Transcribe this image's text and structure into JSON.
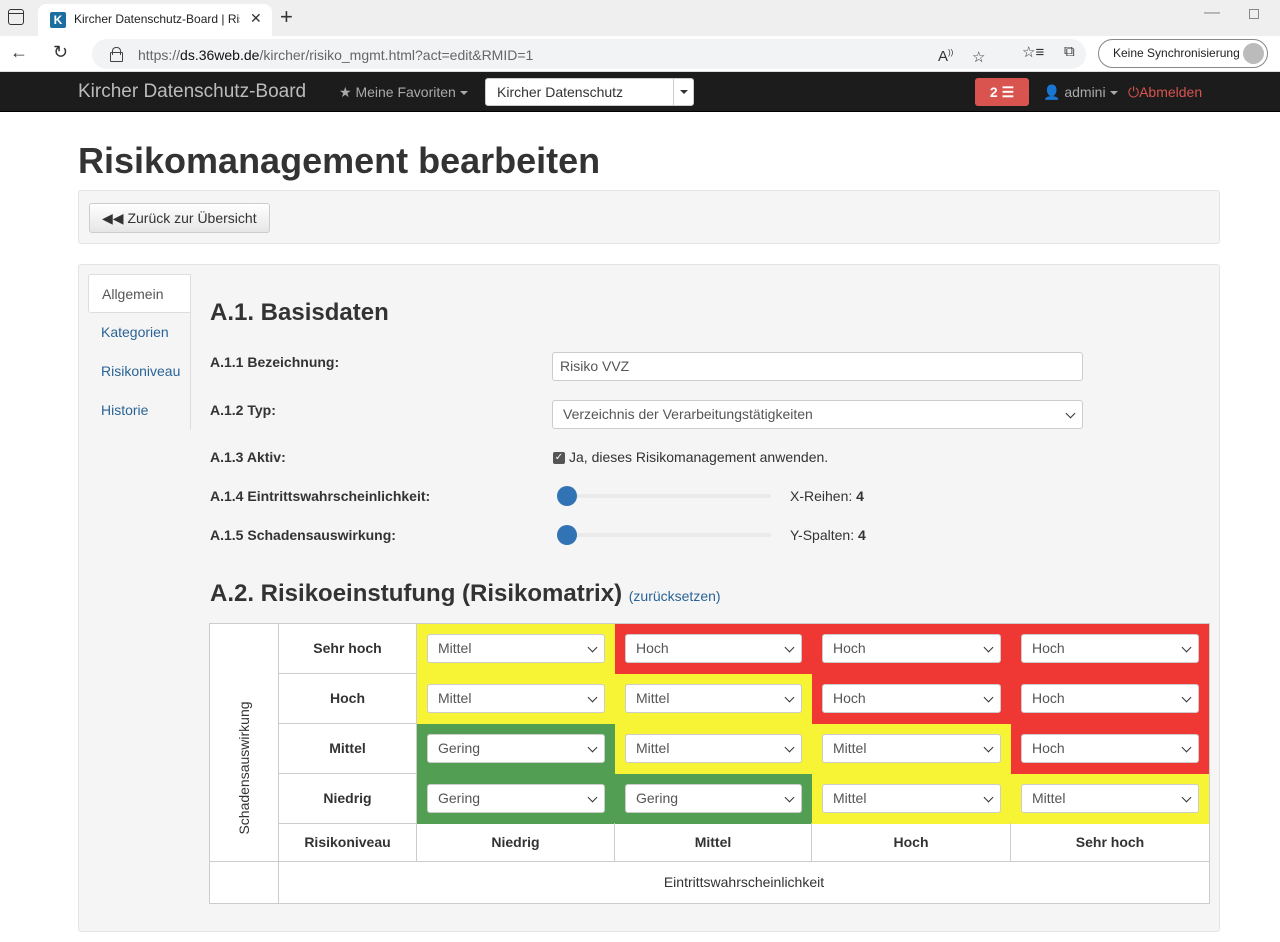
{
  "browser": {
    "tab_title": "Kircher Datenschutz-Board | Risiko",
    "url_prefix": "https://",
    "url_host": "ds.36web.de",
    "url_path": "/kircher/risiko_mgmt.html?act=edit&RMID=1",
    "sync_label": "Keine Synchronisierung",
    "icons": [
      "window-icon",
      "favicon-k",
      "close-icon",
      "plus-icon",
      "back-arrow-icon",
      "reload-icon",
      "lock-icon",
      "read-aloud-icon",
      "favorite-add-icon",
      "favorites-icon",
      "collections-icon",
      "avatar-icon",
      "minimize-icon",
      "maximize-icon"
    ]
  },
  "navbar": {
    "brand": "Kircher Datenschutz-Board",
    "favorites": "Meine Favoriten",
    "selected_company": "Kircher Datenschutz",
    "notification_count": "2",
    "user": "admini",
    "logout": "Abmelden",
    "accent": "#d9534f"
  },
  "page": {
    "title": "Risikomanagement bearbeiten",
    "back_button": "Zurück zur Übersicht"
  },
  "side_nav": {
    "items": [
      "Allgemein",
      "Kategorien",
      "Risikoniveau",
      "Historie"
    ],
    "active": "Allgemein"
  },
  "basisdaten": {
    "heading": "A.1. Basisdaten",
    "bezeichnung_label": "A.1.1 Bezeichnung:",
    "bezeichnung_value": "Risiko VVZ",
    "typ_label": "A.1.2 Typ:",
    "typ_value": "Verzeichnis der Verarbeitungstätigkeiten",
    "aktiv_label": "A.1.3 Aktiv:",
    "aktiv_checked": true,
    "aktiv_text": "Ja, dieses Risikomanagement anwenden.",
    "eintritt_label": "A.1.4 Eintrittswahrscheinlichkeit:",
    "eintritt_prefix": "X-Reihen:",
    "eintritt_value": "4",
    "schaden_label": "A.1.5 Schadensauswirkung:",
    "schaden_prefix": "Y-Spalten:",
    "schaden_value": "4"
  },
  "matrix": {
    "heading": "A.2. Risikoeinstufung (Risikomatrix)",
    "reset_link": "(zurücksetzen)",
    "y_axis_label": "Schadensauswirkung",
    "x_axis_label": "Eintrittswahrscheinlichkeit",
    "corner_label": "Risikoniveau",
    "row_headers": [
      "Sehr hoch",
      "Hoch",
      "Mittel",
      "Niedrig"
    ],
    "col_headers": [
      "Niedrig",
      "Mittel",
      "Hoch",
      "Sehr hoch"
    ],
    "cells": [
      [
        "Mittel",
        "Hoch",
        "Hoch",
        "Hoch"
      ],
      [
        "Mittel",
        "Mittel",
        "Hoch",
        "Hoch"
      ],
      [
        "Gering",
        "Mittel",
        "Mittel",
        "Hoch"
      ],
      [
        "Gering",
        "Gering",
        "Mittel",
        "Mittel"
      ]
    ],
    "level_colors": {
      "Gering": "#529f53",
      "Mittel": "#f6f435",
      "Hoch": "#ef3734"
    }
  }
}
